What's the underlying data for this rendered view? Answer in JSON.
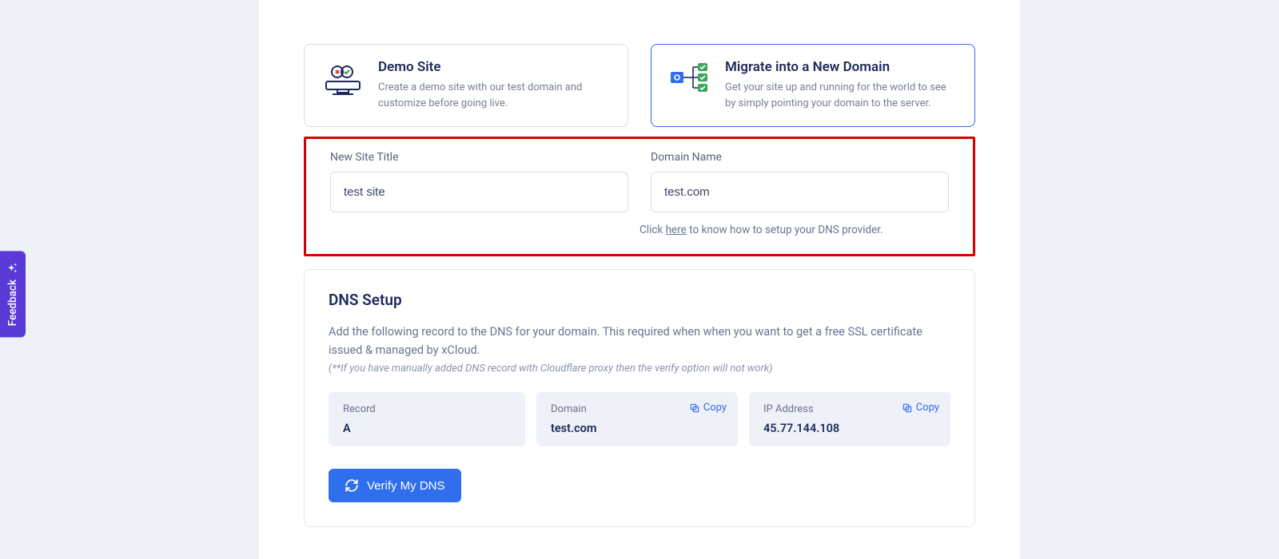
{
  "options": {
    "demo": {
      "title": "Demo Site",
      "desc": "Create a demo site with our test domain and customize before going live."
    },
    "migrate": {
      "title": "Migrate into a New Domain",
      "desc": "Get your site up and running for the world to see by simply pointing your domain to the server."
    }
  },
  "form": {
    "site_title_label": "New Site Title",
    "site_title_value": "test site",
    "domain_label": "Domain Name",
    "domain_value": "test.com",
    "helper_pre": "Click ",
    "helper_link": "here",
    "helper_post": " to know how to setup your DNS provider."
  },
  "dns": {
    "heading": "DNS Setup",
    "desc": "Add the following record to the DNS for your domain. This required when when you want to get a free SSL certificate issued & managed by xCloud.",
    "note": "(**If you have manually added DNS record with Cloudflare proxy then the verify option will not work)",
    "record_label": "Record",
    "record_value": "A",
    "domain_label": "Domain",
    "domain_value": "test.com",
    "ip_label": "IP Address",
    "ip_value": "45.77.144.108",
    "copy_label": "Copy",
    "verify_label": "Verify My DNS"
  },
  "feedback_label": "Feedback"
}
